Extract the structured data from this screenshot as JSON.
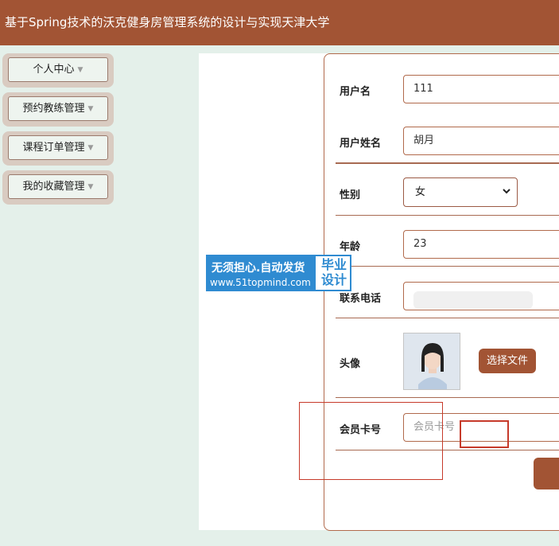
{
  "header": {
    "title": "基于Spring技术的沃克健身房管理系统的设计与实现天津大学"
  },
  "sidebar": {
    "items": [
      {
        "label": "个人中心"
      },
      {
        "label": "预约教练管理"
      },
      {
        "label": "课程订单管理"
      },
      {
        "label": "我的收藏管理"
      }
    ]
  },
  "form": {
    "username": {
      "label": "用户名",
      "value": "111"
    },
    "realname": {
      "label": "用户姓名",
      "value": "胡月"
    },
    "gender": {
      "label": "性别",
      "value": "女"
    },
    "age": {
      "label": "年龄",
      "value": "23"
    },
    "phone": {
      "label": "联系电话",
      "value": ""
    },
    "avatar": {
      "label": "头像",
      "button": "选择文件"
    },
    "card": {
      "label": "会员卡号",
      "placeholder": "会员卡号"
    }
  },
  "watermark": {
    "line1": "无须担心.自动发货",
    "line2": "www.51topmind.com",
    "right": "毕业设计"
  },
  "colors": {
    "accent": "#a25434",
    "sidebar_bg": "#e4f0ea",
    "watermark_blue": "#2f8bd1"
  }
}
